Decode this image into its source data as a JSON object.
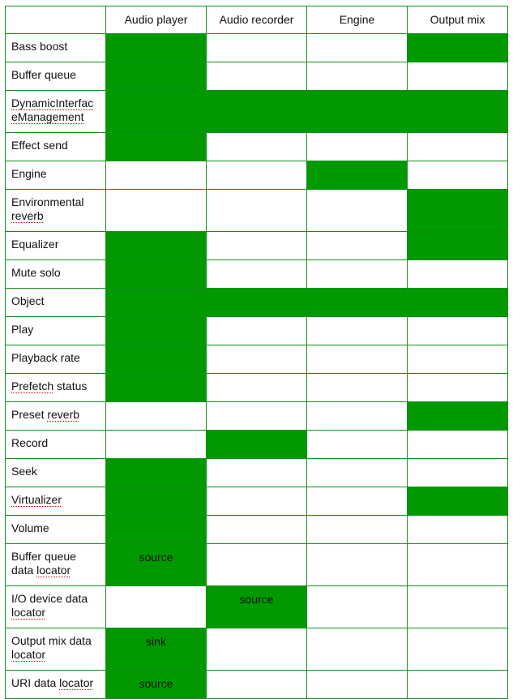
{
  "colors": {
    "supported": "#009900",
    "border": "#12921a",
    "spell_underline": "#cc0000"
  },
  "columns": [
    "",
    "Audio player",
    "Audio recorder",
    "Engine",
    "Output mix"
  ],
  "rows": [
    {
      "label": "Bass boost",
      "cells": [
        true,
        false,
        false,
        true
      ],
      "texts": [
        "",
        "",
        "",
        ""
      ]
    },
    {
      "label": "Buffer queue",
      "cells": [
        true,
        false,
        false,
        false
      ],
      "texts": [
        "",
        "",
        "",
        ""
      ]
    },
    {
      "label": "DynamicInterfaceManagement",
      "cells": [
        true,
        true,
        true,
        true
      ],
      "texts": [
        "",
        "",
        "",
        ""
      ]
    },
    {
      "label": "Effect send",
      "cells": [
        true,
        false,
        false,
        false
      ],
      "texts": [
        "",
        "",
        "",
        ""
      ]
    },
    {
      "label": "Engine",
      "cells": [
        false,
        false,
        true,
        false
      ],
      "texts": [
        "",
        "",
        "",
        ""
      ]
    },
    {
      "label": "Environmental reverb",
      "cells": [
        false,
        false,
        false,
        true
      ],
      "texts": [
        "",
        "",
        "",
        ""
      ]
    },
    {
      "label": "Equalizer",
      "cells": [
        true,
        false,
        false,
        true
      ],
      "texts": [
        "",
        "",
        "",
        ""
      ]
    },
    {
      "label": "Mute solo",
      "cells": [
        true,
        false,
        false,
        false
      ],
      "texts": [
        "",
        "",
        "",
        ""
      ]
    },
    {
      "label": "Object",
      "cells": [
        true,
        true,
        true,
        true
      ],
      "texts": [
        "",
        "",
        "",
        ""
      ]
    },
    {
      "label": "Play",
      "cells": [
        true,
        false,
        false,
        false
      ],
      "texts": [
        "",
        "",
        "",
        ""
      ]
    },
    {
      "label": "Playback rate",
      "cells": [
        true,
        false,
        false,
        false
      ],
      "texts": [
        "",
        "",
        "",
        ""
      ]
    },
    {
      "label": "Prefetch status",
      "cells": [
        true,
        false,
        false,
        false
      ],
      "texts": [
        "",
        "",
        "",
        ""
      ]
    },
    {
      "label": "Preset reverb",
      "cells": [
        false,
        false,
        false,
        true
      ],
      "texts": [
        "",
        "",
        "",
        ""
      ]
    },
    {
      "label": "Record",
      "cells": [
        false,
        true,
        false,
        false
      ],
      "texts": [
        "",
        "",
        "",
        ""
      ]
    },
    {
      "label": "Seek",
      "cells": [
        true,
        false,
        false,
        false
      ],
      "texts": [
        "",
        "",
        "",
        ""
      ]
    },
    {
      "label": "Virtualizer",
      "cells": [
        true,
        false,
        false,
        true
      ],
      "texts": [
        "",
        "",
        "",
        ""
      ]
    },
    {
      "label": "Volume",
      "cells": [
        true,
        false,
        false,
        false
      ],
      "texts": [
        "",
        "",
        "",
        ""
      ]
    },
    {
      "label": "Buffer queue data locator",
      "cells": [
        true,
        false,
        false,
        false
      ],
      "texts": [
        "source",
        "",
        "",
        ""
      ]
    },
    {
      "label": "I/O device data locator",
      "cells": [
        false,
        true,
        false,
        false
      ],
      "texts": [
        "",
        "source",
        "",
        ""
      ]
    },
    {
      "label": "Output mix data locator",
      "cells": [
        true,
        false,
        false,
        false
      ],
      "texts": [
        "sink",
        "",
        "",
        ""
      ]
    },
    {
      "label": "URI data locator",
      "cells": [
        true,
        false,
        false,
        false
      ],
      "texts": [
        "source",
        "",
        "",
        ""
      ]
    }
  ]
}
